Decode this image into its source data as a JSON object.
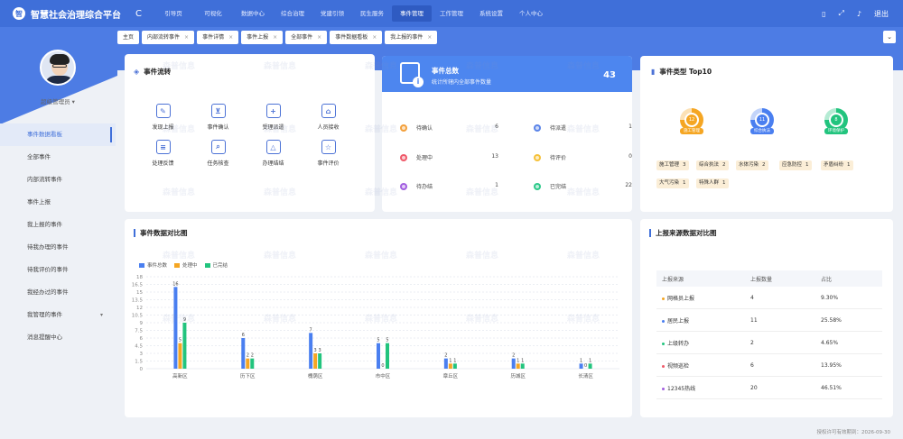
{
  "header": {
    "logo_text": "智",
    "app_title": "智慧社会治理综合平台",
    "refresh_glyph": "C",
    "nav": [
      {
        "label": "引导页",
        "active": false
      },
      {
        "label": "可视化",
        "active": false
      },
      {
        "label": "数据中心",
        "active": false
      },
      {
        "label": "综合治理",
        "active": false
      },
      {
        "label": "党建引领",
        "active": false
      },
      {
        "label": "民生服务",
        "active": false
      },
      {
        "label": "事件管理",
        "active": true
      },
      {
        "label": "工作管理",
        "active": false
      },
      {
        "label": "系统设置",
        "active": false
      },
      {
        "label": "个人中心",
        "active": false
      }
    ],
    "right_icons": [
      "phone-icon",
      "fullscreen-icon",
      "bell-icon"
    ],
    "logout_label": "退出"
  },
  "user": {
    "name": "超级管理员"
  },
  "sidebar": {
    "items": [
      {
        "label": "事件数据看板",
        "active": true,
        "caret": false
      },
      {
        "label": "全部事件",
        "active": false,
        "caret": false
      },
      {
        "label": "内部流转事件",
        "active": false,
        "caret": false
      },
      {
        "label": "事件上报",
        "active": false,
        "caret": false
      },
      {
        "label": "我上报的事件",
        "active": false,
        "caret": false
      },
      {
        "label": "待我办理的事件",
        "active": false,
        "caret": false
      },
      {
        "label": "待我评价的事件",
        "active": false,
        "caret": false
      },
      {
        "label": "我经办过的事件",
        "active": false,
        "caret": false
      },
      {
        "label": "我管理的事件",
        "active": false,
        "caret": true
      },
      {
        "label": "消息提醒中心",
        "active": false,
        "caret": false
      }
    ]
  },
  "tabs": [
    {
      "label": "主页",
      "closable": false
    },
    {
      "label": "内部流转事件",
      "closable": true
    },
    {
      "label": "事件详情",
      "closable": true
    },
    {
      "label": "事件上报",
      "closable": true
    },
    {
      "label": "全部事件",
      "closable": true
    },
    {
      "label": "事件数据看板",
      "closable": true
    },
    {
      "label": "我上报的事件",
      "closable": true
    }
  ],
  "tab_menu_glyph": "⌄",
  "flow_card": {
    "title": "事件流转",
    "items": [
      {
        "label": "发现上报",
        "icon": "pencil-icon",
        "glyph": "✎"
      },
      {
        "label": "事件确认",
        "icon": "user-check-icon",
        "glyph": "⊻"
      },
      {
        "label": "受理派遣",
        "icon": "clipboard-icon",
        "glyph": "+"
      },
      {
        "label": "人员接收",
        "icon": "file-icon",
        "glyph": "⌂"
      },
      {
        "label": "处理反馈",
        "icon": "list-icon",
        "glyph": "≡"
      },
      {
        "label": "任务核查",
        "icon": "doc-search-icon",
        "glyph": "⌕"
      },
      {
        "label": "办理结结",
        "icon": "triangle-icon",
        "glyph": "△"
      },
      {
        "label": "事件评价",
        "icon": "star-icon",
        "glyph": "☆"
      }
    ]
  },
  "total_card": {
    "title": "事件总数",
    "subtitle": "统计所辖内全部事件数量",
    "total": "43",
    "stats": [
      {
        "label": "待确认",
        "value": "6",
        "color": "#f3a03c"
      },
      {
        "label": "待派遣",
        "value": "1",
        "color": "#5b84e8"
      },
      {
        "label": "处理中",
        "value": "13",
        "color": "#ef5a6a"
      },
      {
        "label": "待评价",
        "value": "0",
        "color": "#f5c13a"
      },
      {
        "label": "待办结",
        "value": "1",
        "color": "#a25ee0"
      },
      {
        "label": "已完结",
        "value": "22",
        "color": "#2dc98a"
      }
    ]
  },
  "top10_card": {
    "title": "事件类型 Top10",
    "gauges": [
      {
        "value": "12",
        "caption": "施工管理",
        "color": "#f5a623"
      },
      {
        "value": "11",
        "caption": "综合执法",
        "color": "#4a7ff0"
      },
      {
        "value": "8",
        "caption": "环境保护",
        "color": "#22c47e"
      }
    ],
    "chips": [
      {
        "label": "施工管理",
        "value": "3"
      },
      {
        "label": "综合执法",
        "value": "2"
      },
      {
        "label": "水体污染",
        "value": "2"
      },
      {
        "label": "应急防控",
        "value": "1"
      },
      {
        "label": "矛盾纠纷",
        "value": "1"
      },
      {
        "label": "大气污染",
        "value": "1"
      },
      {
        "label": "特殊人群",
        "value": "1"
      }
    ]
  },
  "chart_card": {
    "title": "事件数据对比图"
  },
  "chart_data": {
    "type": "bar",
    "categories": [
      "高新区",
      "历下区",
      "槐荫区",
      "市中区",
      "章丘区",
      "历城区",
      "长清区"
    ],
    "series": [
      {
        "name": "事件总数",
        "color": "#4a7ff0",
        "values": [
          16,
          6,
          7,
          5,
          2,
          2,
          1
        ]
      },
      {
        "name": "处理中",
        "color": "#f5a623",
        "values": [
          5,
          2,
          3,
          0,
          1,
          1,
          0
        ]
      },
      {
        "name": "已完结",
        "color": "#22c47e",
        "values": [
          9,
          2,
          3,
          5,
          1,
          1,
          1
        ]
      }
    ],
    "yticks": [
      0,
      1.5,
      3,
      4.5,
      6,
      7.5,
      9,
      10.5,
      12,
      13.5,
      15,
      16.5,
      18
    ],
    "ylim": [
      0,
      18
    ],
    "grid": true,
    "legend": "top-left"
  },
  "source_card": {
    "title": "上报来源数据对比图",
    "headers": [
      "上报来源",
      "上报数量",
      "占比"
    ],
    "rows": [
      {
        "source": "网格员上报",
        "count": "4",
        "ratio": "9.30%",
        "color": "#f5a623"
      },
      {
        "source": "居民上报",
        "count": "11",
        "ratio": "25.58%",
        "color": "#4a7ff0"
      },
      {
        "source": "上级转办",
        "count": "2",
        "ratio": "4.65%",
        "color": "#22c47e"
      },
      {
        "source": "视频巡检",
        "count": "6",
        "ratio": "13.95%",
        "color": "#ef5a6a"
      },
      {
        "source": "12345热线",
        "count": "20",
        "ratio": "46.51%",
        "color": "#a25ee0"
      }
    ]
  },
  "footer": {
    "license_text": "授权许可有效期到：2026-09-30"
  },
  "watermark": "森普信息"
}
